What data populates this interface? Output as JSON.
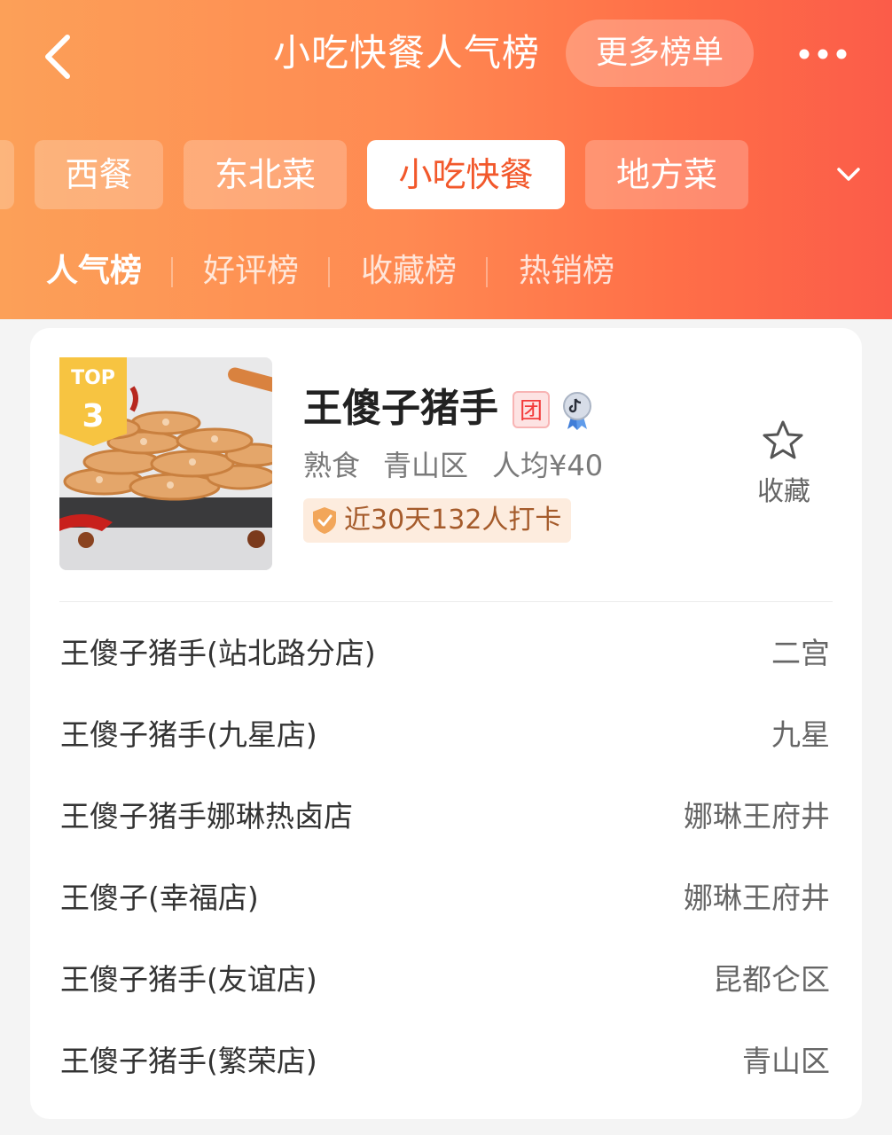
{
  "header": {
    "title": "小吃快餐人气榜",
    "more_button": "更多榜单"
  },
  "categories": [
    {
      "label": "西餐",
      "active": false
    },
    {
      "label": "东北菜",
      "active": false
    },
    {
      "label": "小吃快餐",
      "active": true
    },
    {
      "label": "地方菜",
      "active": false
    }
  ],
  "subtabs": [
    {
      "label": "人气榜",
      "active": true
    },
    {
      "label": "好评榜",
      "active": false
    },
    {
      "label": "收藏榜",
      "active": false
    },
    {
      "label": "热销榜",
      "active": false
    }
  ],
  "shop": {
    "rank_label": "TOP",
    "rank_number": "3",
    "name": "王傻子猪手",
    "tuan_badge": "团",
    "category": "熟食",
    "district": "青山区",
    "avg_price": "人均¥40",
    "checkin": "近30天132人打卡",
    "favorite_label": "收藏"
  },
  "branches": [
    {
      "name": "王傻子猪手(站北路分店)",
      "area": "二宫"
    },
    {
      "name": "王傻子猪手(九星店)",
      "area": "九星"
    },
    {
      "name": "王傻子猪手娜琳热卤店",
      "area": "娜琳王府井"
    },
    {
      "name": "王傻子(幸福店)",
      "area": "娜琳王府井"
    },
    {
      "name": "王傻子猪手(友谊店)",
      "area": "昆都仑区"
    },
    {
      "name": "王傻子猪手(繁荣店)",
      "area": "青山区"
    }
  ],
  "colors": {
    "accent": "#f2582b",
    "header_start": "#fca058",
    "header_end": "#fb5c49"
  },
  "icons": [
    "back-arrow-icon",
    "more-dots-icon",
    "chevron-down-icon",
    "douyin-icon",
    "checkin-shield-icon",
    "star-icon"
  ]
}
